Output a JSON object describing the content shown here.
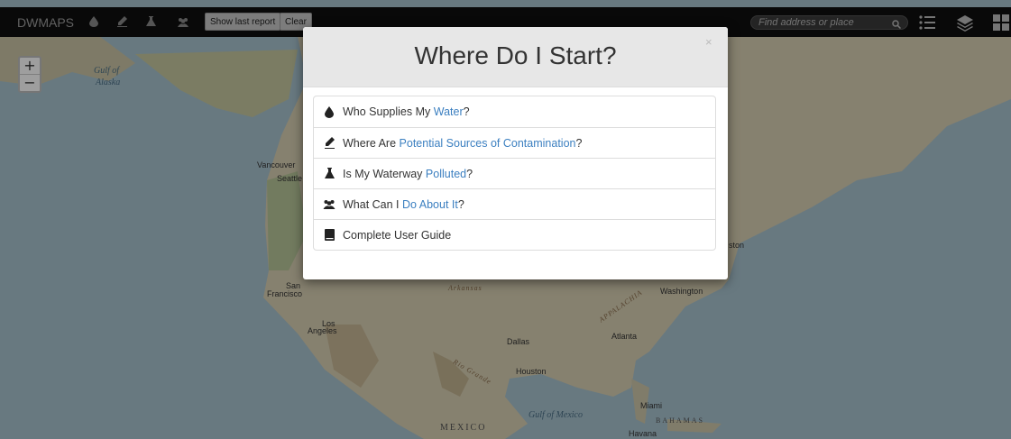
{
  "navbar": {
    "brand": "DWMAPS",
    "show_last_report": "Show last report",
    "clear": "Clear",
    "search_placeholder": "Find address or place",
    "icons": [
      "water-drop-icon",
      "pen-icon",
      "flask-icon",
      "users-icon"
    ],
    "right_icons": [
      "list-icon",
      "layers-icon",
      "grid-icon"
    ]
  },
  "zoom": {
    "in": "+",
    "out": "−"
  },
  "modal": {
    "title": "Where Do I Start?",
    "close": "×",
    "items": [
      {
        "icon": "water-drop-icon",
        "prefix": "Who Supplies My ",
        "highlight": "Water",
        "suffix": "?"
      },
      {
        "icon": "pen-icon",
        "prefix": "Where Are ",
        "highlight": "Potential Sources of Contamination",
        "suffix": "?"
      },
      {
        "icon": "flask-icon",
        "prefix": "Is My Waterway ",
        "highlight": "Polluted",
        "suffix": "?"
      },
      {
        "icon": "users-icon",
        "prefix": "What Can I ",
        "highlight": "Do About It",
        "suffix": "?"
      },
      {
        "icon": "book-icon",
        "prefix": "Complete User Guide",
        "highlight": "",
        "suffix": ""
      }
    ]
  },
  "map_labels": {
    "gulf_of": "Gulf of",
    "alaska": "Alaska",
    "vancouver": "Vancouver",
    "seattle": "Seattle",
    "san": "San",
    "francisco": "Francisco",
    "los": "Los",
    "angeles": "Angeles",
    "dallas": "Dallas",
    "houston": "Houston",
    "atlanta": "Atlanta",
    "washington": "Washington",
    "ston": "ston",
    "gulf_of_mexico": "Gulf of Mexico",
    "mexico": "MEXICO",
    "miami": "Miami",
    "bahamas": "BAHAMAS",
    "havana": "Havana",
    "arkansas": "Arkansas",
    "appalachia": "APPALACHIA",
    "rio_grande": "Rio Grande"
  },
  "colors": {
    "navbar": "#101010",
    "link": "#3b7fc0",
    "ocean": "#a9c3cf",
    "land": "#d9d2b9"
  }
}
